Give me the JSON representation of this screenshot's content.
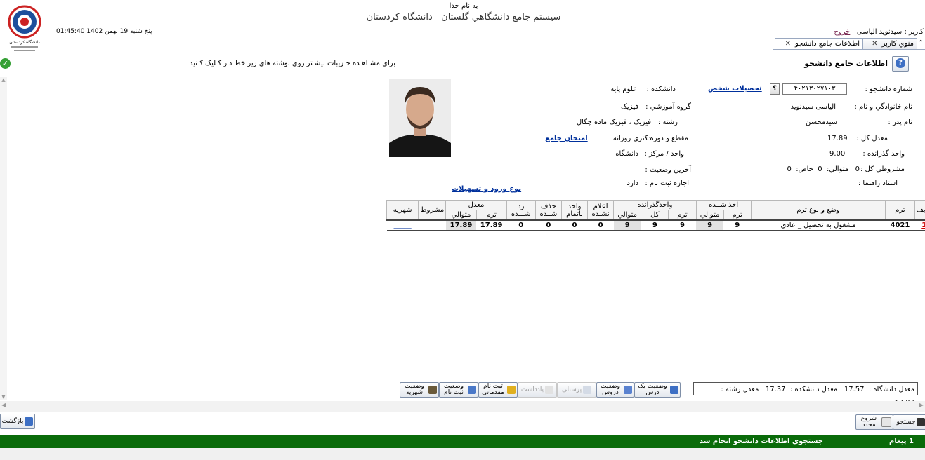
{
  "header": {
    "basmala": "به نام خدا",
    "system_title": "سيستم جامع دانشگاهي گلستان",
    "university_title": "دانشگاه کردستان",
    "user_prefix": "کاربر :",
    "user_name": "سیدنوید الیاسی",
    "logout_label": "خروج",
    "datetime": "01:45:40 پنج شنبه 19 بهمن 1402",
    "logo_caption": "دانشگاه کردستان"
  },
  "tabs": [
    {
      "label": "منوي کاربر"
    },
    {
      "label": "اطلاعات جامع دانشجو"
    }
  ],
  "page": {
    "title": "اطلاعات جامع دانشجو",
    "instruction": "براي مشـاهـده جـزيبات بيشـتر روي نوشته هاي زير خط دار کـليک کـنيد"
  },
  "student": {
    "student_number_label": "شماره دانشجو :",
    "student_number_value": "۴۰۲۱۳۰۲۷۱۰۳",
    "lookup_button": "؟",
    "personal_education_link": "تحصیلات شخص",
    "faculty_label": "دانشکده :",
    "faculty_value": "علوم پايه",
    "name_label": "نام خانوادگي و نام :",
    "name_value": "الیاسی سیدنوید",
    "edu_group_label": "گروه آموزشي :",
    "edu_group_value": "فيزيک",
    "father_label": "نام پدر :",
    "father_value": "سيدمحسن",
    "major_label": "رشته :",
    "major_value": "فيزيک ، فيزيک ماده چگال",
    "gpa_label": "معدل کل :",
    "gpa_value": "17.89",
    "degree_label": "مقطع و دوره :",
    "degree_value": "دکتري  روزانه",
    "comprehensive_exam_link": "امتحان جامع",
    "passed_units_label": "واحد گذرانده :",
    "passed_units_value": "9.00",
    "unit_center_label": "واحد / مرکز :",
    "unit_center_value": "دانشگاه",
    "probation_label": "مشروطي کل :",
    "probation_total": "0",
    "probation_consecutive_label": "متوالي:",
    "probation_consecutive": "0",
    "probation_special_label": "خاص:",
    "probation_special": "0",
    "last_status_label": "آخرين وضعيت :",
    "last_status_value": "",
    "advisor_label": "استاد راهنما :",
    "advisor_value": "",
    "reg_permission_label": "اجازه ثبت نام :",
    "reg_permission_value": "دارد",
    "entry_type_link": "نوع ورود و تسهيلات"
  },
  "terms_table": {
    "headers_top": {
      "row": "رديف",
      "term": "ترم",
      "status": "وضع و نوع ترم",
      "taken": "اخذ شــده",
      "passed": "واحدگذرانده",
      "announced": "اعلام نشـده",
      "incomplete": "واحد ناتمام",
      "dropped": "حذف شــده",
      "rejected": "رد شـــده",
      "gpa": "معدل",
      "probation": "مشروط",
      "tuition": "شهريه"
    },
    "headers_sub": {
      "taken_term": "ترم",
      "taken_consecutive": "متوالي",
      "passed_term": "ترم",
      "passed_total": "کل",
      "passed_consecutive": "متوالي",
      "gpa_term": "ترم",
      "gpa_consecutive": "متوالي"
    },
    "rows": [
      {
        "row": "1",
        "term": "4021",
        "status": "مشغول به تحصيل _ عادي",
        "taken_term": "9",
        "taken_consecutive": "9",
        "passed_term": "9",
        "passed_total": "9",
        "passed_consecutive": "9",
        "announced": "0",
        "incomplete": "0",
        "dropped": "0",
        "rejected": "0",
        "gpa_term": "17.89",
        "gpa_consecutive": "17.89",
        "probation": "",
        "tuition": "_____"
      }
    ]
  },
  "averages": {
    "university_label": "معدل دانشگاه :",
    "university_value": "17.57",
    "faculty_label": "معدل دانشکده :",
    "faculty_value": "17.37",
    "major_label": "معدل رشته :",
    "major_value": "17.07"
  },
  "actions": {
    "single_course_status": "وضعیت یک درس",
    "courses_status": "وضعیت دروس",
    "personnel": "پرسنلی",
    "note": "یادداشت",
    "pre_registration": "ثبت نام مقدماتی",
    "registration_status": "وضعیت ثبت نام",
    "tuition_status": "وضعیت شهریه"
  },
  "footer": {
    "back_label": "بازگشت",
    "search_label": "جستجو",
    "restart_label": "شروع مجدد",
    "message_count": "1 پيغام",
    "message_text": "جستجوي اطلاعات دانشجو انجام شد"
  },
  "colors": {
    "link": "#00309c",
    "status_bar": "#0a6b0a",
    "row_link": "#cc0000"
  }
}
